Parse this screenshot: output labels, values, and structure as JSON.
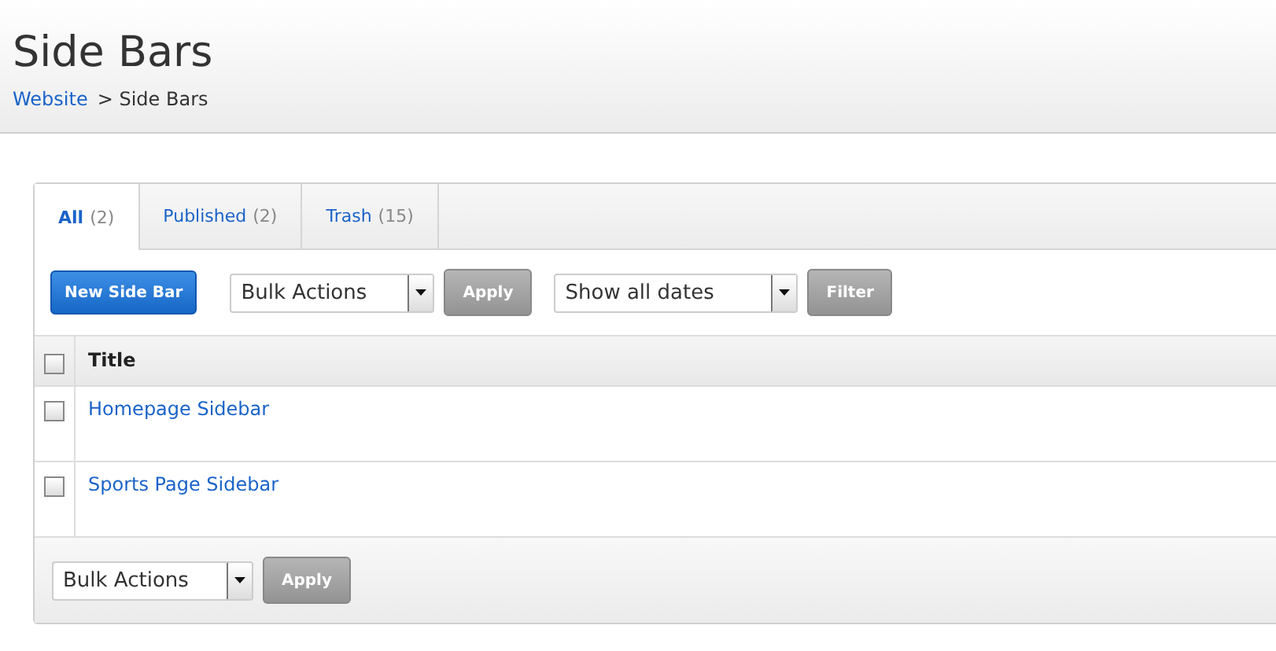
{
  "page": {
    "title": "Side Bars",
    "breadcrumb": [
      {
        "label": "Website",
        "link": true
      },
      {
        "label": "> Side Bars",
        "link": false
      }
    ]
  },
  "tabs": [
    {
      "label": "All",
      "count": "(2)",
      "selected": true
    },
    {
      "label": "Published",
      "count": "(2)",
      "selected": false
    },
    {
      "label": "Trash",
      "count": "(15)",
      "selected": false
    }
  ],
  "toolbar": {
    "new_button": "New Side Bar",
    "bulk_select": "Bulk Actions",
    "apply_button": "Apply",
    "date_select": "Show all dates",
    "filter_button": "Filter"
  },
  "table": {
    "columns": [
      "Title"
    ],
    "header_checked": false,
    "rows": [
      {
        "title": "Homepage Sidebar",
        "checked": false
      },
      {
        "title": "Sports Page Sidebar",
        "checked": false
      }
    ]
  },
  "footer": {
    "bulk_select": "Bulk Actions",
    "apply_button": "Apply"
  }
}
